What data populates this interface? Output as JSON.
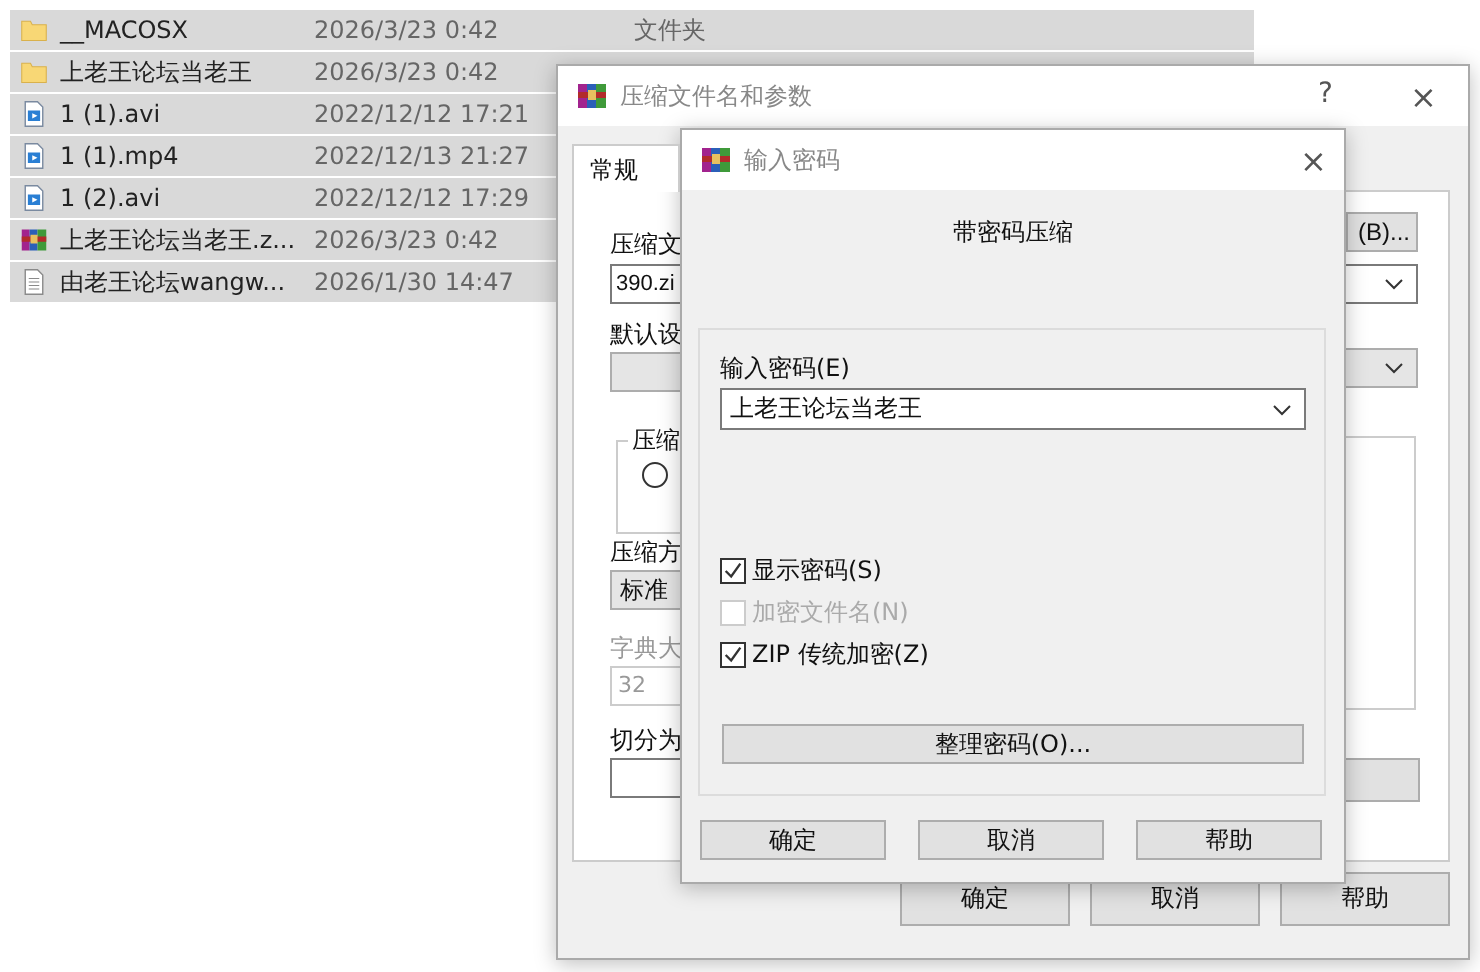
{
  "file_list": {
    "rows": [
      {
        "kind": "folder",
        "name": "__MACOSX",
        "modified": "2026/3/23 0:42",
        "type": "文件夹",
        "selected": true
      },
      {
        "kind": "folder",
        "name": "上老王论坛当老王",
        "modified": "2026/3/23 0:42",
        "selected": true
      },
      {
        "kind": "video",
        "name": "1 (1).avi",
        "modified": "2022/12/12 17:21",
        "selected": true
      },
      {
        "kind": "video",
        "name": "1 (1).mp4",
        "modified": "2022/12/13 21:27",
        "selected": true
      },
      {
        "kind": "video",
        "name": "1 (2).avi",
        "modified": "2022/12/12 17:29",
        "selected": true
      },
      {
        "kind": "archive",
        "name": "上老王论坛当老王.z...",
        "modified": "2026/3/23 0:42",
        "selected": true
      },
      {
        "kind": "text",
        "name": "由老王论坛wangw...",
        "modified": "2026/1/30 14:47",
        "selected": true
      }
    ]
  },
  "archive_dialog": {
    "title": "压缩文件名和参数",
    "help": "?",
    "close": "×",
    "tabs": [
      {
        "label": "常规",
        "selected": true
      }
    ],
    "archive_name_label": "压缩文",
    "browse_button": "(B)...",
    "archive_name_value": "390.zi",
    "profile_label": "默认设",
    "format_group_label": "压缩",
    "format_options": [
      {
        "selected": false
      }
    ],
    "compression_method_label": "压缩方",
    "compression_method_value": "标准",
    "dictionary_label": "字典大",
    "dictionary_value": "32",
    "split_label": "切分为",
    "buttons": [
      "确定",
      "取消",
      "帮助"
    ]
  },
  "password_dialog": {
    "title": "输入密码",
    "close": "×",
    "heading": "带密码压缩",
    "password_label": "输入密码(E)",
    "password_value": "上老王论坛当老王",
    "options": [
      {
        "label": "显示密码(S)",
        "checked": true,
        "disabled": false
      },
      {
        "label": "加密文件名(N)",
        "checked": false,
        "disabled": true
      },
      {
        "label": "ZIP 传统加密(Z)",
        "checked": true,
        "disabled": false
      }
    ],
    "organize_button": "整理密码(O)...",
    "buttons": [
      "确定",
      "取消",
      "帮助"
    ]
  }
}
